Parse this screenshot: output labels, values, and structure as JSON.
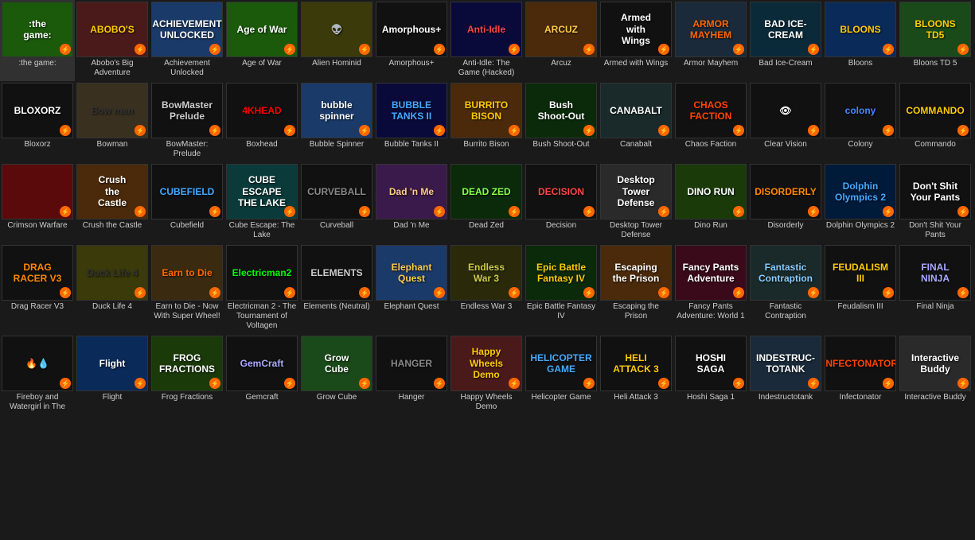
{
  "grid": {
    "games": [
      {
        "id": "the-game",
        "label": ":the game:",
        "bg": "bg-grass",
        "text": ":the\ngame:",
        "textColor": "#ffffff"
      },
      {
        "id": "abobos-big-adventure",
        "label": "Abobo's Big Adventure",
        "bg": "bg-red",
        "text": "ABOBO'S",
        "textColor": "#ffcc00"
      },
      {
        "id": "achievement-unlocked",
        "label": "Achievement Unlocked",
        "bg": "bg-blue",
        "text": "ACHIEVEMENT\nUNLOCKED",
        "textColor": "#ffffff"
      },
      {
        "id": "age-of-war",
        "label": "Age of War",
        "bg": "bg-grass",
        "text": "Age of War",
        "textColor": "#ffffff"
      },
      {
        "id": "alien-hominid",
        "label": "Alien Hominid",
        "bg": "bg-yellow",
        "text": "👽",
        "textColor": "#ffff00"
      },
      {
        "id": "amorphous-plus",
        "label": "Amorphous+",
        "bg": "bg-dark",
        "text": "Amorphous+",
        "textColor": "#ffffff"
      },
      {
        "id": "anti-idle",
        "label": "Anti-Idle: The Game (Hacked)",
        "bg": "bg-navy",
        "text": "Anti-Idle",
        "textColor": "#ff4444"
      },
      {
        "id": "arcuz",
        "label": "Arcuz",
        "bg": "bg-brown",
        "text": "ARCUZ",
        "textColor": "#ffcc44"
      },
      {
        "id": "armed-with-wings",
        "label": "Armed with Wings",
        "bg": "bg-dark",
        "text": "Armed\nwith\nWings",
        "textColor": "#ffffff"
      },
      {
        "id": "armor-mayhem",
        "label": "Armor Mayhem",
        "bg": "bg-steel",
        "text": "ARMOR\nMAYHEM",
        "textColor": "#ff6600"
      },
      {
        "id": "bad-ice-cream",
        "label": "Bad Ice-Cream",
        "bg": "bg-cyan",
        "text": "BAD ICE-CREAM",
        "textColor": "#ffffff"
      },
      {
        "id": "bloons",
        "label": "Bloons",
        "bg": "bg-sky",
        "text": "BLOONS",
        "textColor": "#ffcc00"
      },
      {
        "id": "bloons-td5",
        "label": "Bloons TD 5",
        "bg": "bg-green",
        "text": "BLOONS\nTD5",
        "textColor": "#ffcc00"
      },
      {
        "id": "bloxorz",
        "label": "Bloxorz",
        "bg": "bg-dark",
        "text": "BLOXORZ",
        "textColor": "#ffffff"
      },
      {
        "id": "bowman",
        "label": "Bowman",
        "bg": "bg-cream",
        "text": "Bow man",
        "textColor": "#333333"
      },
      {
        "id": "bowmaster-prelude",
        "label": "BowMaster: Prelude",
        "bg": "bg-dark",
        "text": "BowMaster\nPrelude",
        "textColor": "#cccccc"
      },
      {
        "id": "boxhead",
        "label": "Boxhead",
        "bg": "bg-dark",
        "text": "4KHEAD",
        "textColor": "#ff0000"
      },
      {
        "id": "bubble-spinner",
        "label": "Bubble Spinner",
        "bg": "bg-blue",
        "text": "bubble\nspinner",
        "textColor": "#ffffff"
      },
      {
        "id": "bubble-tanks-2",
        "label": "Bubble Tanks II",
        "bg": "bg-navy",
        "text": "BUBBLE\nTANKS II",
        "textColor": "#44aaff"
      },
      {
        "id": "burrito-bison",
        "label": "Burrito Bison",
        "bg": "bg-orange",
        "text": "BURRITO\nBISON",
        "textColor": "#ffcc00"
      },
      {
        "id": "bush-shoot-out",
        "label": "Bush Shoot-Out",
        "bg": "bg-forest",
        "text": "Bush\nShoot-Out",
        "textColor": "#ffffff"
      },
      {
        "id": "canabalt",
        "label": "Canabalt",
        "bg": "bg-slate",
        "text": "CANABALT",
        "textColor": "#ffffff"
      },
      {
        "id": "chaos-faction",
        "label": "Chaos Faction",
        "bg": "bg-dark",
        "text": "CHAOS\nFACTION",
        "textColor": "#ff4400"
      },
      {
        "id": "clear-vision",
        "label": "Clear Vision",
        "bg": "bg-dark",
        "text": "👁",
        "textColor": "#ffffff"
      },
      {
        "id": "colony",
        "label": "Colony",
        "bg": "bg-dark",
        "text": "colony",
        "textColor": "#4488ff"
      },
      {
        "id": "commando",
        "label": "Commando",
        "bg": "bg-dark",
        "text": "COMMANDO",
        "textColor": "#ffcc00"
      },
      {
        "id": "crimson-warfare",
        "label": "Crimson Warfare",
        "bg": "bg-crimson",
        "text": "",
        "textColor": "#ff4444"
      },
      {
        "id": "crush-the-castle",
        "label": "Crush the Castle",
        "bg": "bg-brown",
        "text": "Crush\nthe\nCastle",
        "textColor": "#ffffff"
      },
      {
        "id": "cubefield",
        "label": "Cubefield",
        "bg": "bg-dark",
        "text": "CUBEFIELD",
        "textColor": "#44aaff"
      },
      {
        "id": "cube-escape-lake",
        "label": "Cube Escape: The Lake",
        "bg": "bg-teal",
        "text": "CUBE ESCAPE\nTHE LAKE",
        "textColor": "#ffffff"
      },
      {
        "id": "curveball",
        "label": "Curveball",
        "bg": "bg-dark",
        "text": "CURVEBALL",
        "textColor": "#888888"
      },
      {
        "id": "dad-n-me",
        "label": "Dad 'n Me",
        "bg": "bg-purple",
        "text": "Dad 'n Me",
        "textColor": "#ffcc88"
      },
      {
        "id": "dead-zed",
        "label": "Dead Zed",
        "bg": "bg-forest",
        "text": "DEAD ZED",
        "textColor": "#88ff44"
      },
      {
        "id": "decision",
        "label": "Decision",
        "bg": "bg-dark",
        "text": "DECISION",
        "textColor": "#ff4444"
      },
      {
        "id": "desktop-tower-defense",
        "label": "Desktop Tower Defense",
        "bg": "bg-gray",
        "text": "Desktop\nTower\nDefense",
        "textColor": "#ffffff"
      },
      {
        "id": "dino-run",
        "label": "Dino Run",
        "bg": "bg-lime",
        "text": "DINO RUN",
        "textColor": "#ffffff"
      },
      {
        "id": "disorderly",
        "label": "Disorderly",
        "bg": "bg-dark",
        "text": "DISORDERLY",
        "textColor": "#ff8800"
      },
      {
        "id": "dolphin-olympics-2",
        "label": "Dolphin Olympics 2",
        "bg": "bg-ocean",
        "text": "Dolphin\nOlympics 2",
        "textColor": "#44aaff"
      },
      {
        "id": "dont-shit-your-pants",
        "label": "Don't Shit Your Pants",
        "bg": "bg-dark",
        "text": "Don't Shit\nYour Pants",
        "textColor": "#ffffff"
      },
      {
        "id": "drag-racer-v3",
        "label": "Drag Racer V3",
        "bg": "bg-dark",
        "text": "DRAG\nRACER V3",
        "textColor": "#ff8800"
      },
      {
        "id": "duck-life-4",
        "label": "Duck Life 4",
        "bg": "bg-yellow",
        "text": "Duck Life 4",
        "textColor": "#333333"
      },
      {
        "id": "earn-to-die",
        "label": "Earn to Die - Now With Super Wheel!",
        "bg": "bg-sand",
        "text": "Earn to Die",
        "textColor": "#ff6600"
      },
      {
        "id": "electricman-2",
        "label": "Electricman 2 - The Tournament of Voltagen",
        "bg": "bg-dark",
        "text": "Electricman2",
        "textColor": "#00ff00"
      },
      {
        "id": "elements-neutral",
        "label": "Elements (Neutral)",
        "bg": "bg-dark",
        "text": "ELEMENTS",
        "textColor": "#cccccc"
      },
      {
        "id": "elephant-quest",
        "label": "Elephant Quest",
        "bg": "bg-blue",
        "text": "Elephant\nQuest",
        "textColor": "#ffcc44"
      },
      {
        "id": "endless-war-3",
        "label": "Endless War 3",
        "bg": "bg-olive",
        "text": "Endless\nWar 3",
        "textColor": "#cccc44"
      },
      {
        "id": "epic-battle-fantasy-4",
        "label": "Epic Battle Fantasy IV",
        "bg": "bg-forest",
        "text": "Epic Battle\nFantasy IV",
        "textColor": "#ffcc00"
      },
      {
        "id": "escaping-the-prison",
        "label": "Escaping the Prison",
        "bg": "bg-orange",
        "text": "Escaping\nthe Prison",
        "textColor": "#ffffff"
      },
      {
        "id": "fancy-pants-adventure",
        "label": "Fancy Pants Adventure: World 1",
        "bg": "bg-rose",
        "text": "Fancy Pants\nAdventure",
        "textColor": "#ffffff"
      },
      {
        "id": "fantastic-contraption",
        "label": "Fantastic Contraption",
        "bg": "bg-slate",
        "text": "Fantastic\nContraption",
        "textColor": "#88ccff"
      },
      {
        "id": "feudalism-3",
        "label": "Feudalism III",
        "bg": "bg-dark",
        "text": "FEUDALISM\nIII",
        "textColor": "#ffcc00"
      },
      {
        "id": "final-ninja",
        "label": "Final Ninja",
        "bg": "bg-dark",
        "text": "FINAL\nNINJA",
        "textColor": "#aaaaff"
      },
      {
        "id": "fireboy-and-watergirl",
        "label": "Fireboy and Watergirl in The",
        "bg": "bg-dark",
        "text": "🔥💧",
        "textColor": "#ffffff"
      },
      {
        "id": "flight",
        "label": "Flight",
        "bg": "bg-sky",
        "text": "Flight",
        "textColor": "#ffffff"
      },
      {
        "id": "frog-fractions",
        "label": "Frog Fractions",
        "bg": "bg-lime",
        "text": "FROG\nFRACTIONS",
        "textColor": "#ffffff"
      },
      {
        "id": "gemcraft",
        "label": "Gemcraft",
        "bg": "bg-dark",
        "text": "GemCraft",
        "textColor": "#aaaaff"
      },
      {
        "id": "grow-cube",
        "label": "Grow Cube",
        "bg": "bg-green",
        "text": "Grow\nCube",
        "textColor": "#ffffff"
      },
      {
        "id": "hanger",
        "label": "Hanger",
        "bg": "bg-dark",
        "text": "HANGER",
        "textColor": "#888888"
      },
      {
        "id": "happy-wheels-demo",
        "label": "Happy Wheels Demo",
        "bg": "bg-red",
        "text": "Happy\nWheels\nDemo",
        "textColor": "#ffcc00"
      },
      {
        "id": "helicopter-game",
        "label": "Helicopter Game",
        "bg": "bg-dark",
        "text": "HELICOPTER\nGAME",
        "textColor": "#44aaff"
      },
      {
        "id": "heli-attack-3",
        "label": "Heli Attack 3",
        "bg": "bg-dark",
        "text": "HELI\nATTACK 3",
        "textColor": "#ffcc00"
      },
      {
        "id": "hoshi-saga-1",
        "label": "Hoshi Saga 1",
        "bg": "bg-dark",
        "text": "HOSHI\nSAGA",
        "textColor": "#ffffff"
      },
      {
        "id": "indestructotank",
        "label": "Indestructotank",
        "bg": "bg-steel",
        "text": "INDESTRUC-\nTOTANK",
        "textColor": "#ffffff"
      },
      {
        "id": "infectonator",
        "label": "Infectonator",
        "bg": "bg-dark",
        "text": "INFECTONATOR",
        "textColor": "#ff4400"
      },
      {
        "id": "interactive-buddy",
        "label": "Interactive Buddy",
        "bg": "bg-gray",
        "text": "Interactive\nBuddy",
        "textColor": "#ffffff"
      }
    ]
  },
  "flash_icon": "⚡"
}
